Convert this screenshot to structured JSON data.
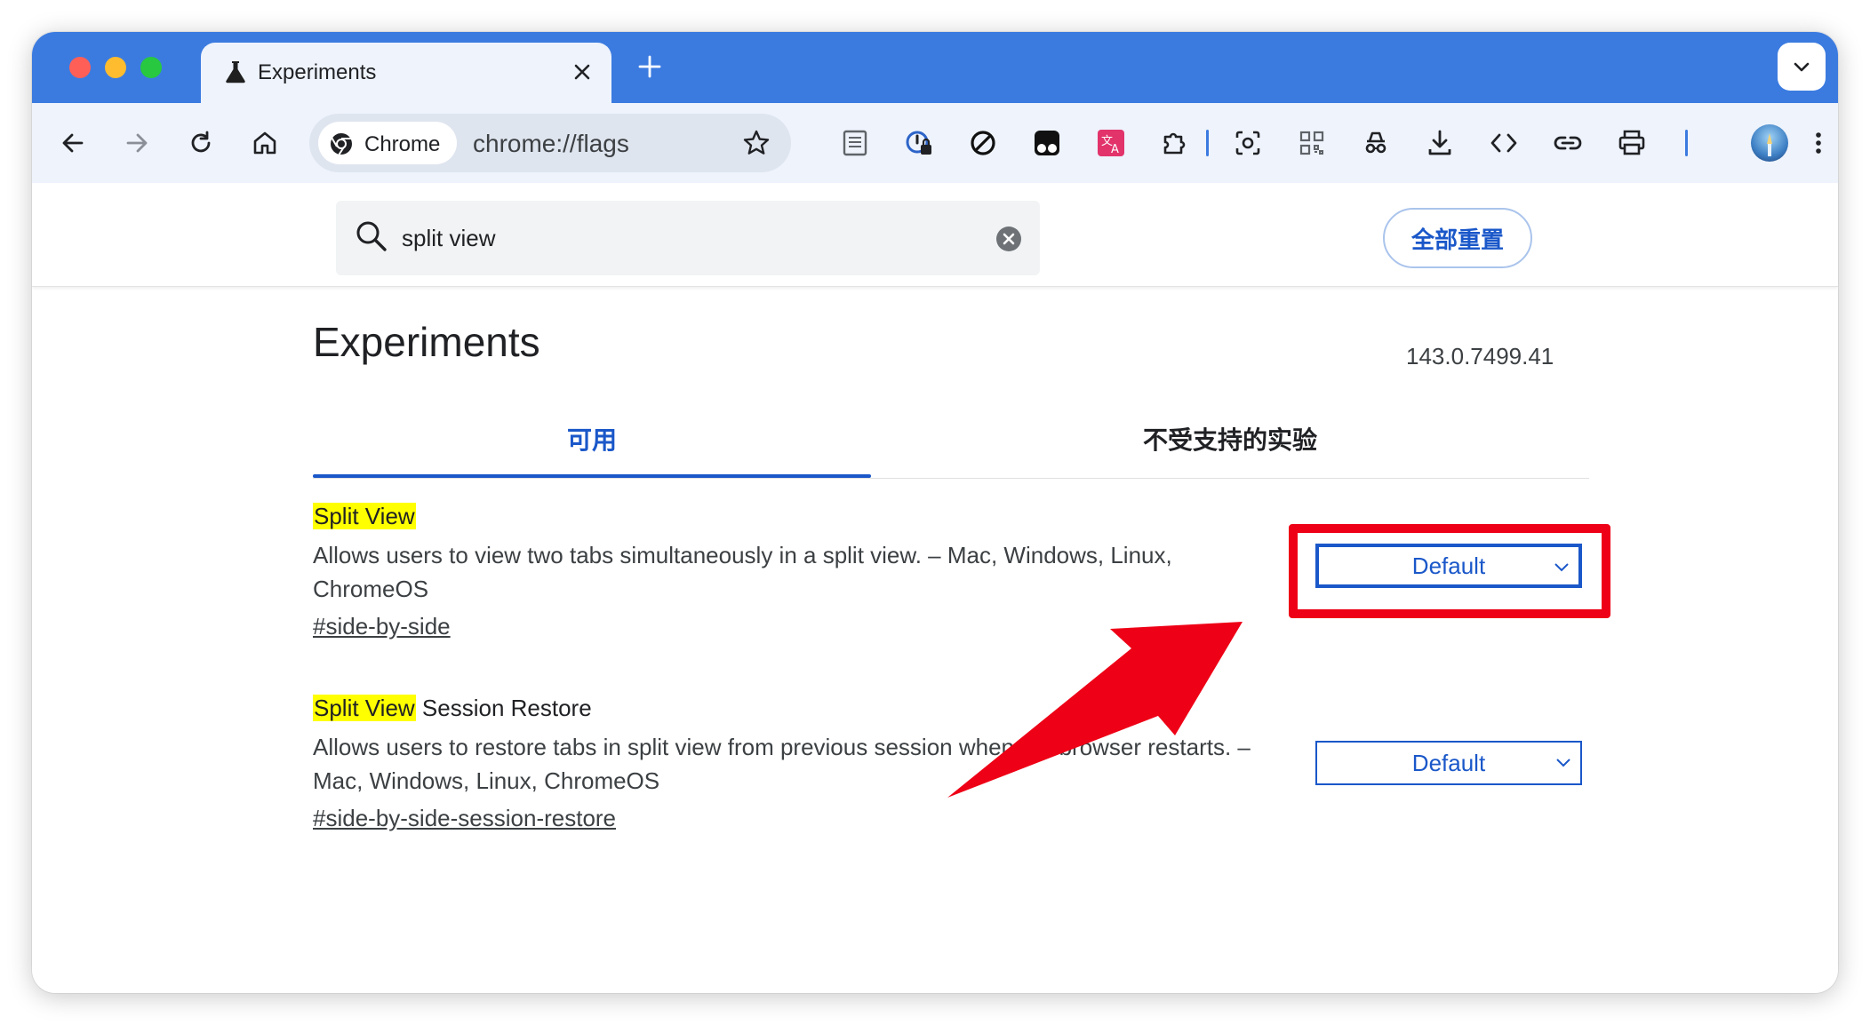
{
  "window": {
    "tab_title": "Experiments"
  },
  "toolbar": {
    "chip_label": "Chrome",
    "url": "chrome://flags"
  },
  "search": {
    "value": "split view",
    "reset_label": "全部重置"
  },
  "page": {
    "title": "Experiments",
    "version": "143.0.7499.41",
    "tabs": [
      {
        "label": "可用",
        "active": true
      },
      {
        "label": "不受支持的实验",
        "active": false
      }
    ]
  },
  "flags": [
    {
      "title_highlight": "Split View",
      "title_rest": "",
      "description": "Allows users to view two tabs simultaneously in a split view. – Mac, Windows, Linux, ChromeOS",
      "link": "#side-by-side",
      "value": "Default"
    },
    {
      "title_highlight": "Split View",
      "title_rest": " Session Restore",
      "description": "Allows users to restore tabs in split view from previous session when the browser restarts. – Mac, Windows, Linux, ChromeOS",
      "link": "#side-by-side-session-restore",
      "value": "Default"
    }
  ],
  "colors": {
    "tabstrip": "#3b7be0",
    "toolbar": "#eef3fc",
    "accent": "#1a57c9",
    "highlight": "#ffff00",
    "annotation": "#ee0016"
  }
}
